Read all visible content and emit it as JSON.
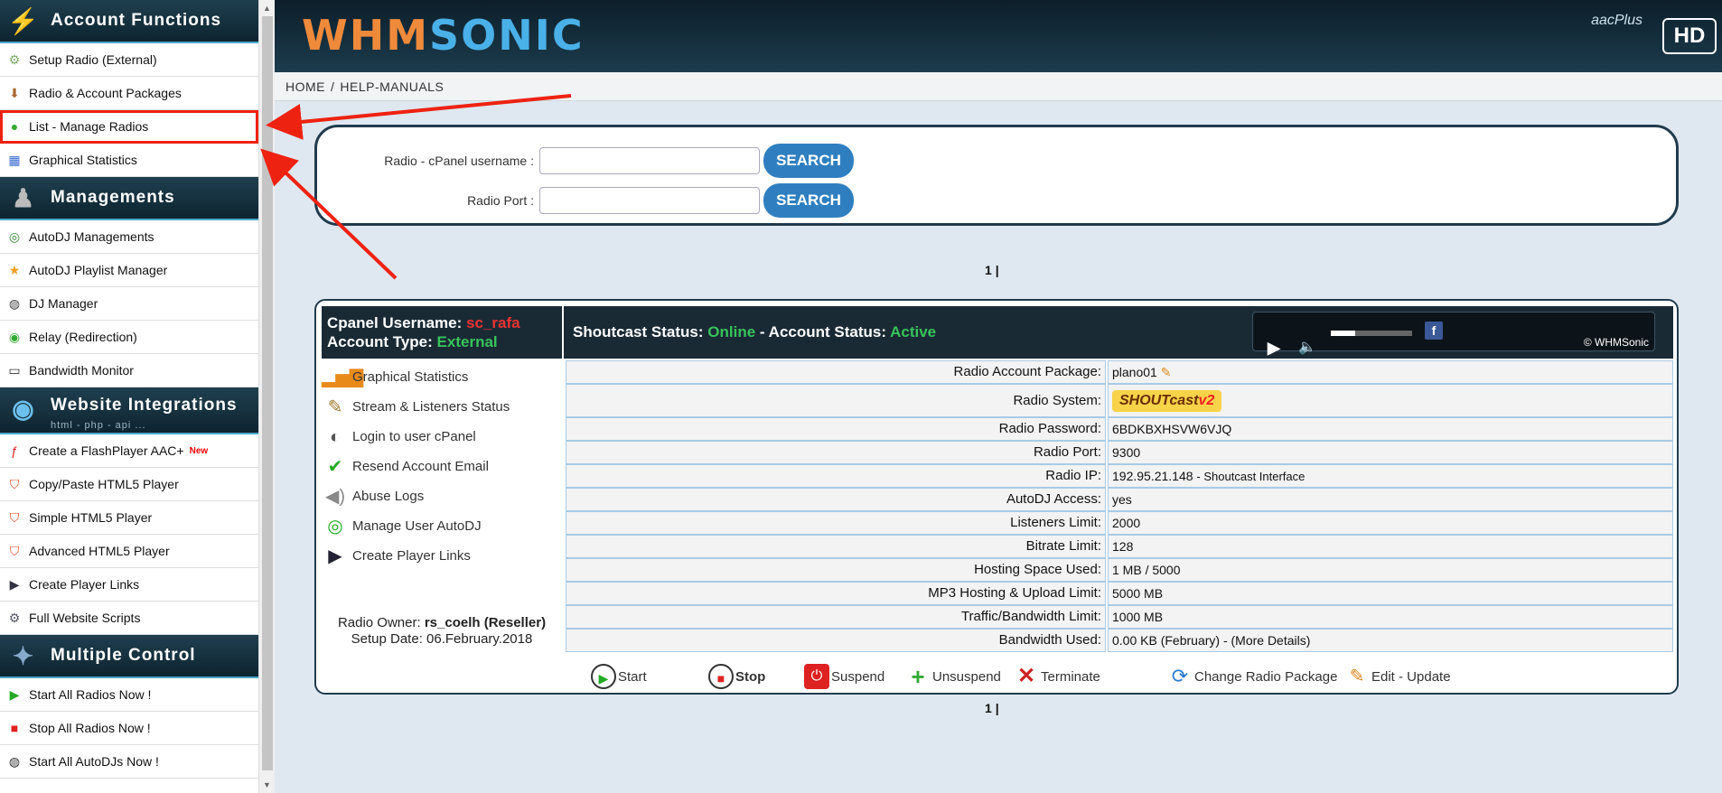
{
  "sidebar": {
    "sections": [
      {
        "title": "Account Functions",
        "icon": "lightning-icon",
        "items": [
          {
            "label": "Setup Radio (External)",
            "icon": "setup-radio-icon"
          },
          {
            "label": "Radio & Account Packages",
            "icon": "download-package-icon"
          },
          {
            "label": "List - Manage Radios",
            "icon": "radio-list-icon"
          },
          {
            "label": "Graphical Statistics",
            "icon": "statistics-icon"
          }
        ]
      },
      {
        "title": "Managements",
        "icon": "person-icon",
        "items": [
          {
            "label": "AutoDJ Managements",
            "icon": "headphones-icon"
          },
          {
            "label": "AutoDJ Playlist Manager",
            "icon": "star-icon"
          },
          {
            "label": "DJ Manager",
            "icon": "dj-headset-icon"
          },
          {
            "label": "Relay (Redirection)",
            "icon": "relay-icon"
          },
          {
            "label": "Bandwidth Monitor",
            "icon": "monitor-icon"
          }
        ]
      },
      {
        "title": "Website Integrations",
        "subtitle": "html - php - api ...",
        "icon": "globe-icon",
        "items": [
          {
            "label": "Create a FlashPlayer AAC+",
            "icon": "flash-icon",
            "badge": "New"
          },
          {
            "label": "Copy/Paste HTML5 Player",
            "icon": "html5-icon"
          },
          {
            "label": "Simple HTML5 Player",
            "icon": "html5-icon"
          },
          {
            "label": "Advanced HTML5 Player",
            "icon": "html5-icon"
          },
          {
            "label": "Create Player Links",
            "icon": "play-link-icon"
          },
          {
            "label": "Full Website Scripts",
            "icon": "scripts-icon"
          }
        ]
      },
      {
        "title": "Multiple Control",
        "icon": "satellite-icon",
        "items": [
          {
            "label": "Start All Radios Now !",
            "icon": "start-icon"
          },
          {
            "label": "Stop All Radios Now !",
            "icon": "stop-icon"
          },
          {
            "label": "Start All AutoDJs Now !",
            "icon": "autodj-start-icon"
          }
        ]
      }
    ]
  },
  "header": {
    "logo_part1": "WHM",
    "logo_part2": "SONIC",
    "aacplus": "aacPlus",
    "hd": "HD"
  },
  "breadcrumb": {
    "home": "HOME",
    "separator": "/",
    "current": "HELP-MANUALS"
  },
  "search": {
    "username_label": "Radio - cPanel username :",
    "username_value": "",
    "port_label": "Radio Port :",
    "port_value": "",
    "button_label": "SEARCH"
  },
  "pager": {
    "current": "1",
    "separator": "|"
  },
  "account": {
    "cpanel_label": "Cpanel Username:",
    "cpanel_value": "sc_rafa",
    "type_label": "Account Type:",
    "type_value": "External",
    "shoutcast_label": "Shoutcast Status:",
    "shoutcast_value": "Online",
    "status_sep": "-",
    "account_status_label": "Account Status:",
    "account_status_value": "Active",
    "player": {
      "copyright": "© WHMSonic",
      "fb": "f",
      "volume_level": 0.3
    },
    "menu": [
      {
        "label": "Graphical Statistics",
        "icon": "bar-chart-icon"
      },
      {
        "label": "Stream & Listeners Status",
        "icon": "guitar-icon"
      },
      {
        "label": "Login to user cPanel",
        "icon": "cpanel-icon"
      },
      {
        "label": "Resend Account Email",
        "icon": "checkmark-icon"
      },
      {
        "label": "Abuse Logs",
        "icon": "speaker-icon"
      },
      {
        "label": "Manage User AutoDJ",
        "icon": "headphones-icon"
      },
      {
        "label": "Create Player Links",
        "icon": "play-circle-icon"
      }
    ],
    "owner_label": "Radio Owner:",
    "owner_value": "rs_coelh (Reseller)",
    "setup_label": "Setup Date:",
    "setup_value": "06.February.2018",
    "info": [
      {
        "key": "Radio Account Package:",
        "value": "plano01"
      },
      {
        "key": "Radio System:",
        "value": "SHOUTcast",
        "badge": "v2"
      },
      {
        "key": "Radio Password:",
        "value": "6BDKBXHSVW6VJQ"
      },
      {
        "key": "Radio Port:",
        "value": "9300"
      },
      {
        "key": "Radio IP:",
        "value": "192.95.21.148",
        "extra": "- Shoutcast Interface"
      },
      {
        "key": "AutoDJ Access:",
        "value": "yes"
      },
      {
        "key": "Listeners Limit:",
        "value": "2000"
      },
      {
        "key": "Bitrate Limit:",
        "value": "128"
      },
      {
        "key": "Hosting Space Used:",
        "value": "1 MB / 5000"
      },
      {
        "key": "MP3 Hosting & Upload Limit:",
        "value": "5000 MB"
      },
      {
        "key": "Traffic/Bandwidth Limit:",
        "value": "1000 MB"
      },
      {
        "key": "Bandwidth Used:",
        "value": "0.00 KB (February) - (More Details)"
      }
    ],
    "actions": [
      {
        "label": "Start",
        "icon": "start-icon"
      },
      {
        "label": "Stop",
        "icon": "stop-icon"
      },
      {
        "label": "Suspend",
        "icon": "power-icon"
      },
      {
        "label": "Unsuspend",
        "icon": "plus-icon"
      },
      {
        "label": "Terminate",
        "icon": "x-icon"
      },
      {
        "label": "Change Radio Package",
        "icon": "refresh-icon"
      },
      {
        "label": "Edit - Update",
        "icon": "pencil-icon"
      }
    ]
  },
  "colors": {
    "header_dark": "#0c1e2a",
    "accent_blue": "#2f7fc0",
    "online_green": "#37c35a",
    "username_red": "#e33",
    "annotation_red": "#e21"
  }
}
